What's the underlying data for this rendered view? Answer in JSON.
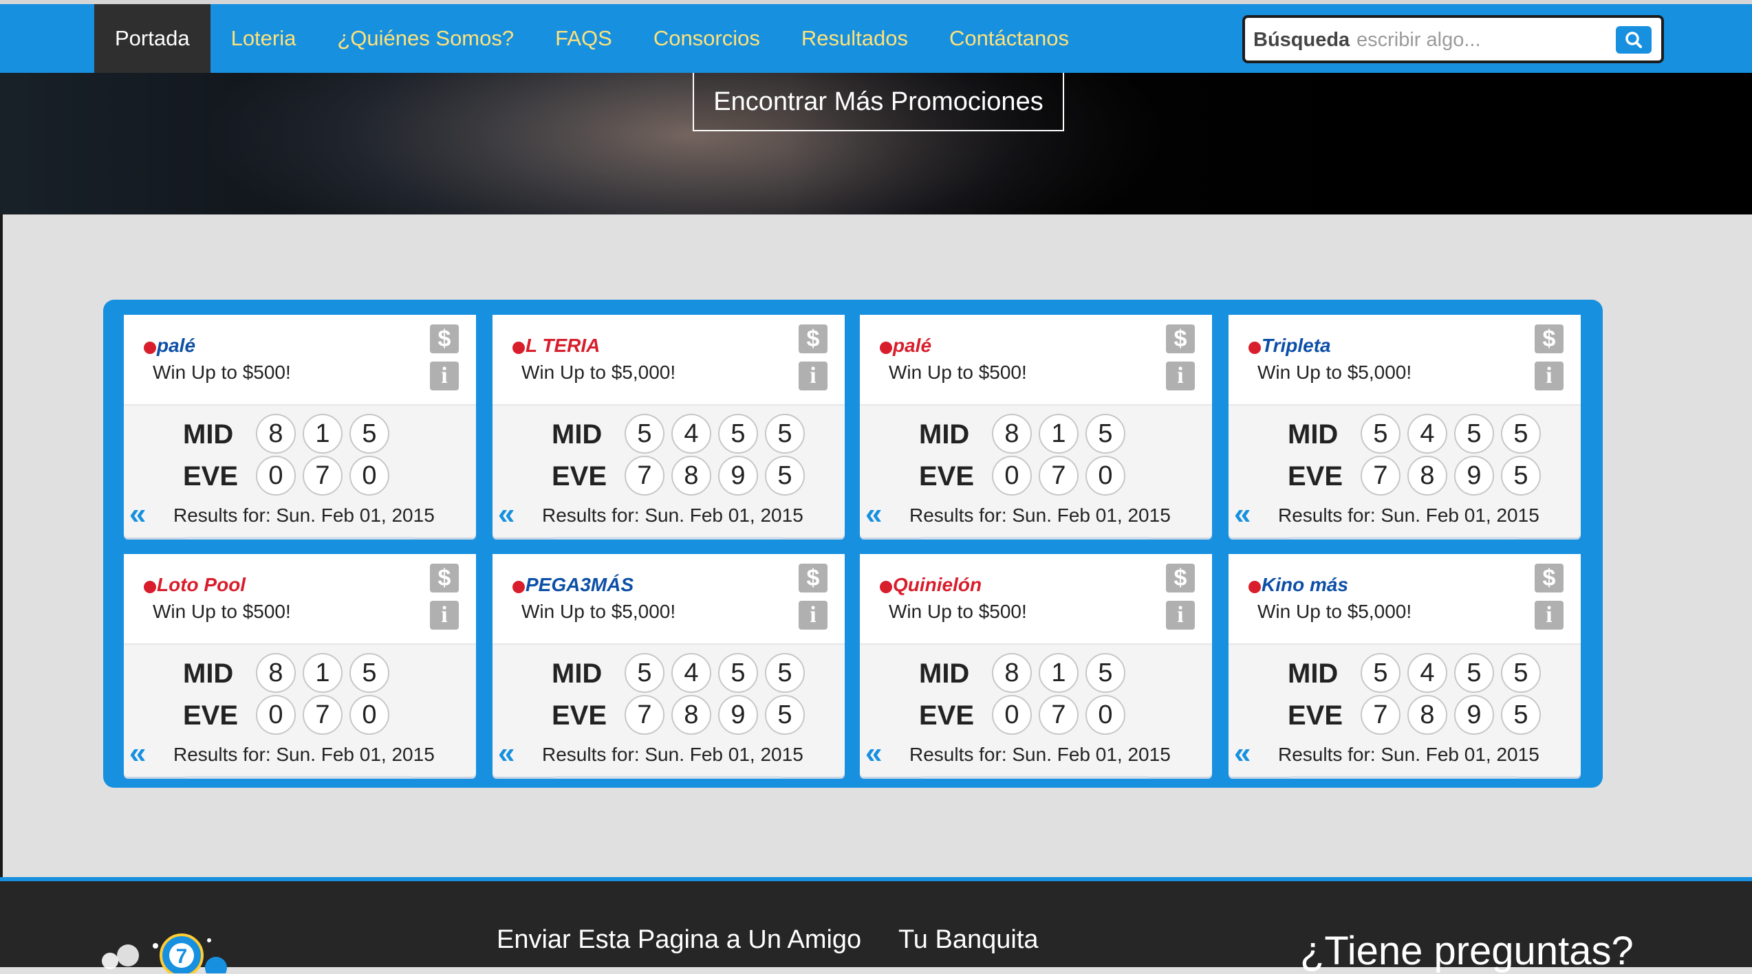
{
  "nav": {
    "items": [
      {
        "label": "Portada",
        "active": true
      },
      {
        "label": "Loteria"
      },
      {
        "label": "¿Quiénes Somos?"
      },
      {
        "label": "FAQS"
      },
      {
        "label": "Consorcios"
      },
      {
        "label": "Resultados"
      },
      {
        "label": "Contáctanos"
      }
    ]
  },
  "search": {
    "label": "Búsqueda",
    "placeholder": "escribir algo..."
  },
  "hero": {
    "button": "Encontrar Más Promociones"
  },
  "cards": [
    {
      "logo": "Quiniela Palé",
      "logo_text": "palé",
      "win": "Win Up to $500!",
      "mid_label": "MID",
      "mid": [
        "8",
        "1",
        "5"
      ],
      "eve_label": "EVE",
      "eve": [
        "0",
        "7",
        "0"
      ],
      "results": "Results for: Sun. Feb 01, 2015"
    },
    {
      "logo": "Loteria Nacional",
      "logo_text": "L TERIA",
      "win": "Win Up to $5,000!",
      "mid_label": "MID",
      "mid": [
        "5",
        "4",
        "5",
        "5"
      ],
      "eve_label": "EVE",
      "eve": [
        "7",
        "8",
        "9",
        "5"
      ],
      "results": "Results for: Sun. Feb 01, 2015"
    },
    {
      "logo": "Super Palé",
      "logo_text": "palé",
      "win": "Win Up to $500!",
      "mid_label": "MID",
      "mid": [
        "8",
        "1",
        "5"
      ],
      "eve_label": "EVE",
      "eve": [
        "0",
        "7",
        "0"
      ],
      "results": "Results for: Sun. Feb 01, 2015"
    },
    {
      "logo": "Tripleta",
      "logo_text": "Tripleta",
      "win": "Win Up to $5,000!",
      "mid_label": "MID",
      "mid": [
        "5",
        "4",
        "5",
        "5"
      ],
      "eve_label": "EVE",
      "eve": [
        "7",
        "8",
        "9",
        "5"
      ],
      "results": "Results for: Sun. Feb 01, 2015"
    },
    {
      "logo": "Loto Pool",
      "logo_text": "Loto Pool",
      "win": "Win Up to $500!",
      "mid_label": "MID",
      "mid": [
        "8",
        "1",
        "5"
      ],
      "eve_label": "EVE",
      "eve": [
        "0",
        "7",
        "0"
      ],
      "results": "Results for: Sun. Feb 01, 2015"
    },
    {
      "logo": "Pega 3 Más",
      "logo_text": "PEGA3MÁS",
      "win": "Win Up to $5,000!",
      "mid_label": "MID",
      "mid": [
        "5",
        "4",
        "5",
        "5"
      ],
      "eve_label": "EVE",
      "eve": [
        "7",
        "8",
        "9",
        "5"
      ],
      "results": "Results for: Sun. Feb 01, 2015"
    },
    {
      "logo": "Quinielón",
      "logo_text": "Quinielón",
      "win": "Win Up to $500!",
      "mid_label": "MID",
      "mid": [
        "8",
        "1",
        "5"
      ],
      "eve_label": "EVE",
      "eve": [
        "0",
        "7",
        "0"
      ],
      "results": "Results for: Sun. Feb 01, 2015"
    },
    {
      "logo": "Kino Más",
      "logo_text": "Kino más",
      "win": "Win Up to $5,000!",
      "mid_label": "MID",
      "mid": [
        "5",
        "4",
        "5",
        "5"
      ],
      "eve_label": "EVE",
      "eve": [
        "7",
        "8",
        "9",
        "5"
      ],
      "results": "Results for: Sun. Feb 01, 2015"
    }
  ],
  "card_buttons": {
    "dollar": "$",
    "info": "i",
    "prev": "«"
  },
  "footer": {
    "link1": "Enviar Esta Pagina a Un Amigo",
    "link2": "Tu Banquita",
    "question": "¿Tiene preguntas?"
  },
  "colors": {
    "primary": "#1790e0",
    "nav_text": "#ffe27a",
    "footer": "#262626"
  }
}
